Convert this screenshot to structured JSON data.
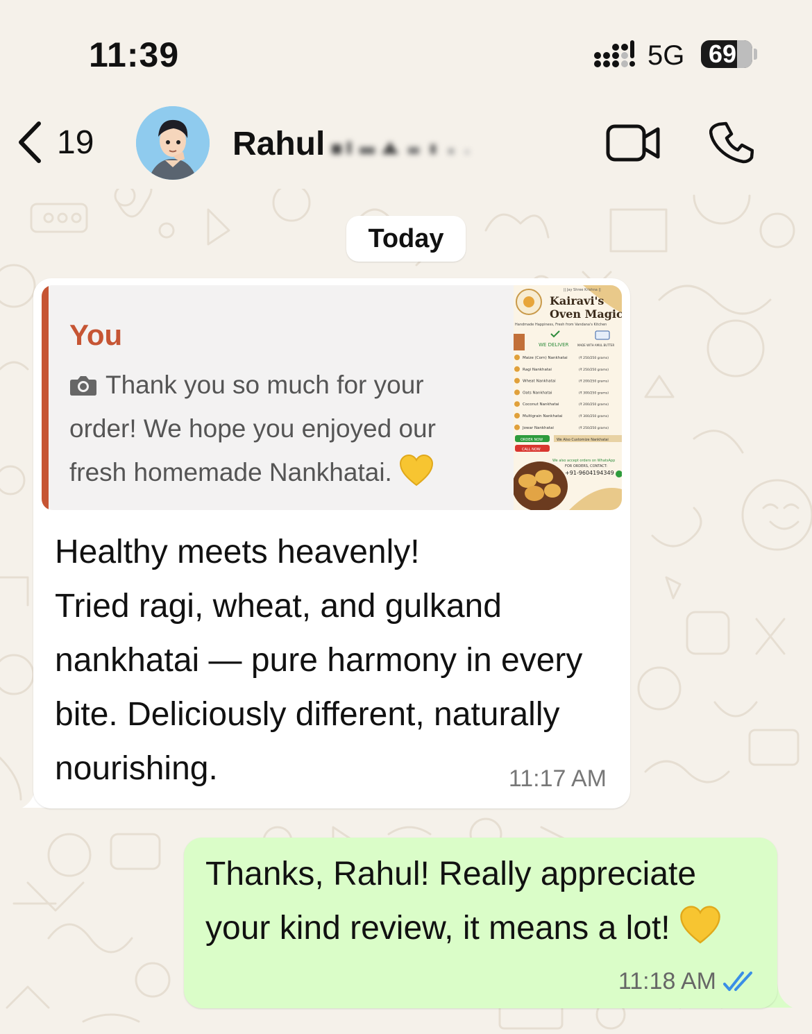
{
  "status_bar": {
    "time": "11:39",
    "network": "5G",
    "battery": "69"
  },
  "header": {
    "back_count": "19",
    "contact_name": "Rahul"
  },
  "date_chip": "Today",
  "messages": {
    "incoming": {
      "quote_author": "You",
      "quote_text": "Thank you so much for your order! We hope you enjoyed our fresh homemade Nankhatai.",
      "text_lines": [
        "Healthy meets heavenly!",
        "Tried ragi, wheat, and gulkand nankhatai — pure harmony in every bite. Deliciously different, naturally nourishing."
      ],
      "time": "11:17 AM"
    },
    "outgoing": {
      "text": "Thanks, Rahul! Really appreciate your kind review, it means a lot!",
      "time": "11:18 AM"
    }
  },
  "flyer": {
    "top_line": "|| Jay Shree Krishna ||",
    "brand": [
      "Kairavi's",
      "Oven Magic"
    ],
    "tagline": "Handmade Happiness, Fresh from Vandana's Kitchen",
    "deliver": "WE DELIVER",
    "butter": "MADE WITH AMUL BUTTER",
    "items": [
      {
        "name": "Maize (Corn) Nankhatai",
        "price": "(₹ 250/250 grams)"
      },
      {
        "name": "Ragi Nankhatai",
        "price": "(₹ 250/250 grams)"
      },
      {
        "name": "Wheat Nankhatai",
        "price": "(₹ 200/250 grams)"
      },
      {
        "name": "Oats Nankhatai",
        "price": "(₹ 300/250 grams)"
      },
      {
        "name": "Coconut Nankhatai",
        "price": "(₹ 200/250 grams)"
      },
      {
        "name": "Multigrain Nankhatai",
        "price": "(₹ 300/250 grams)"
      },
      {
        "name": "Jowar Nankhatai",
        "price": "(₹ 250/250 grams)"
      }
    ],
    "order_now": "ORDER NOW",
    "call_now": "CALL NOW",
    "customize": "We Also Customize Nankhatai",
    "orders_line": "We also accept orders on WhatsApp",
    "contact_label": "FOR ORDERS, CONTACT:",
    "phone": "+91-9604194349"
  },
  "colors": {
    "quote_accent": "#c65534",
    "outgoing_bubble": "#dafdc8",
    "read_ticks": "#3a8ee6",
    "wallpaper": "#f5f1ea"
  },
  "icons": {
    "back": "chevron-left-icon",
    "video": "video-camera-icon",
    "call": "phone-icon",
    "camera": "camera-icon",
    "heart": "yellow-heart-icon",
    "ticks": "double-check-icon"
  }
}
